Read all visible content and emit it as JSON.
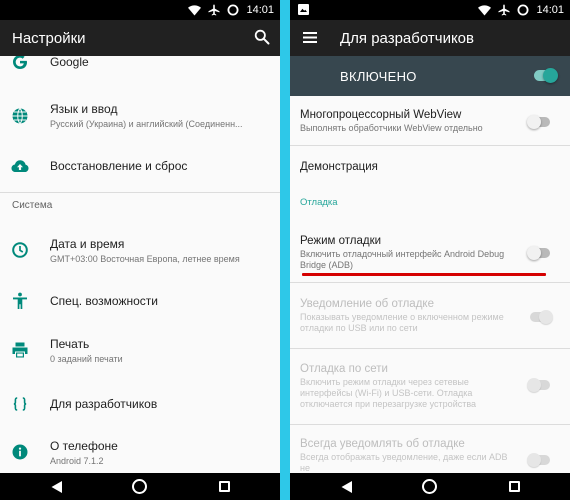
{
  "statusbar": {
    "time": "14:01"
  },
  "colors": {
    "divider_band": "#2ec8e8",
    "appbar": "#212121",
    "accent_teal": "#26a69a",
    "master_bar": "#37474f",
    "icon_teal": "#00897b",
    "highlight_red": "#d50000"
  },
  "left": {
    "appbar": {
      "title": "Настройки",
      "action_icon": "search-icon"
    },
    "items_top": [
      {
        "icon": "google-icon",
        "title": "Google"
      },
      {
        "icon": "globe-icon",
        "title": "Язык и ввод",
        "subtitle": "Русский (Украина) и английский (Соединенн..."
      },
      {
        "icon": "cloud-upload-icon",
        "title": "Восстановление и сброс"
      }
    ],
    "section_system": "Система",
    "items_system": [
      {
        "icon": "clock-icon",
        "title": "Дата и время",
        "subtitle": "GMT+03:00 Восточная Европа, летнее время"
      },
      {
        "icon": "accessibility-icon",
        "title": "Спец. возможности"
      },
      {
        "icon": "printer-icon",
        "title": "Печать",
        "subtitle": "0 заданий печати"
      },
      {
        "icon": "braces-icon",
        "title": "Для разработчиков"
      },
      {
        "icon": "info-icon",
        "title": "О телефоне",
        "subtitle": "Android 7.1.2"
      }
    ]
  },
  "right": {
    "appbar": {
      "title": "Для разработчиков",
      "nav_icon": "menu-icon"
    },
    "master": {
      "label": "ВКЛЮЧЕНО",
      "on": true
    },
    "items": [
      {
        "title": "Многопроцессорный WebView",
        "subtitle": "Выполнять обработчики WebView отдельно",
        "toggle": true,
        "checked": false,
        "enabled": true
      },
      {
        "title": "Демонстрация",
        "toggle": false,
        "enabled": true
      }
    ],
    "section_debug": "Отладка",
    "debug_items": [
      {
        "title": "Режим отладки",
        "subtitle": "Включить отладочный интерфейс Android Debug Bridge (ADB)",
        "toggle": true,
        "checked": false,
        "enabled": true
      },
      {
        "title": "Уведомление об отладке",
        "subtitle": "Показывать уведомление о включенном режиме отладки по USB или по сети",
        "toggle": true,
        "checked": true,
        "enabled": false
      },
      {
        "title": "Отладка по сети",
        "subtitle": "Включить режим отладки через сетевые интерфейсы (Wi-Fi) и USB-сети. Отладка отключается при перезагрузке устройства",
        "toggle": true,
        "checked": false,
        "enabled": false
      },
      {
        "title": "Всегда уведомлять об отладке",
        "subtitle": "Всегда отображать уведомление, даже если ADB не",
        "toggle": true,
        "checked": false,
        "enabled": false
      }
    ]
  },
  "navbar": {
    "back": "back-icon",
    "home": "home-icon",
    "recent": "recent-apps-icon"
  }
}
